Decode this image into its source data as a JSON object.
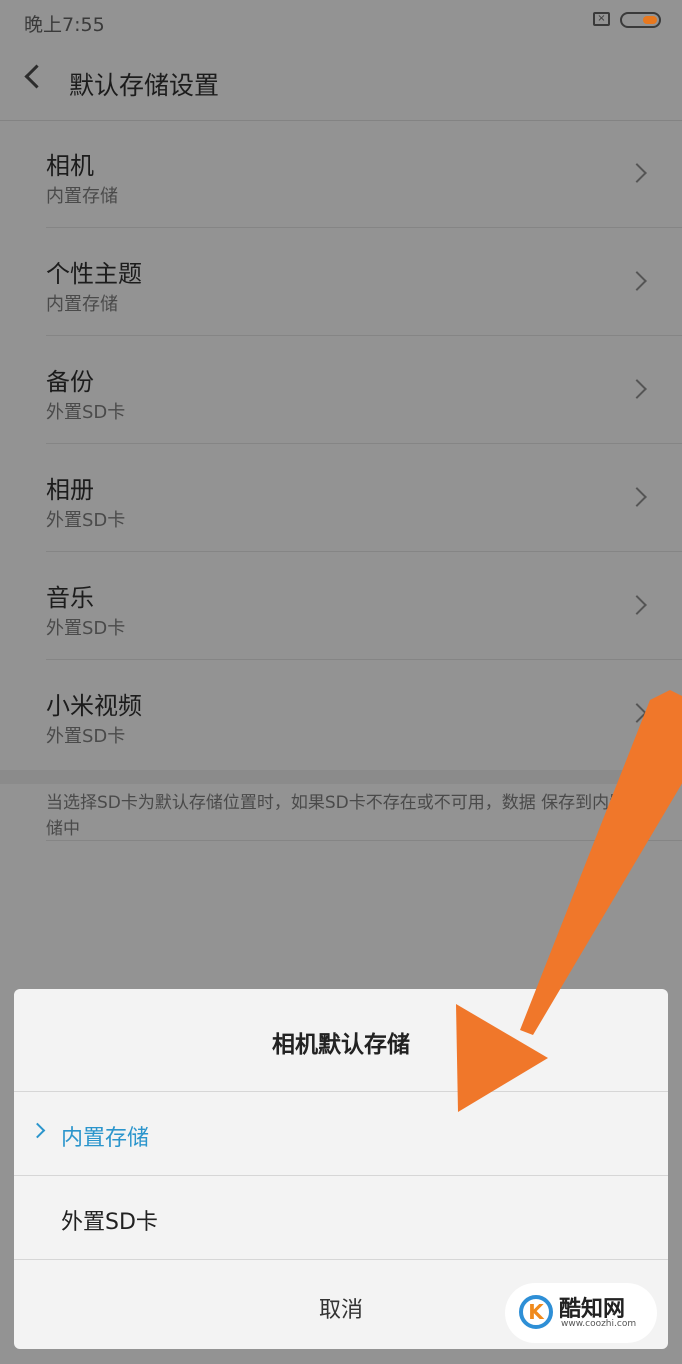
{
  "status": {
    "time": "晚上7:55",
    "sim_icon": "sim-off-icon",
    "battery_color": "#e8781e"
  },
  "header": {
    "title": "默认存储设置"
  },
  "items": [
    {
      "title": "相机",
      "value": "内置存储"
    },
    {
      "title": "个性主题",
      "value": "内置存储"
    },
    {
      "title": "备份",
      "value": "外置SD卡"
    },
    {
      "title": "相册",
      "value": "外置SD卡"
    },
    {
      "title": "音乐",
      "value": "外置SD卡"
    },
    {
      "title": "小米视频",
      "value": "外置SD卡"
    }
  ],
  "note": "当选择SD卡为默认存储位置时，如果SD卡不存在或不可用，数据 保存到内置存储中",
  "dialog": {
    "title": "相机默认存储",
    "options": [
      {
        "label": "内置存储",
        "selected": true
      },
      {
        "label": "外置SD卡",
        "selected": false
      }
    ],
    "cancel": "取消"
  },
  "watermark": {
    "name": "酷知网",
    "url": "www.coozhi.com",
    "logo": "K"
  },
  "colors": {
    "accent": "#2b95cc",
    "arrow": "#f0772a"
  }
}
